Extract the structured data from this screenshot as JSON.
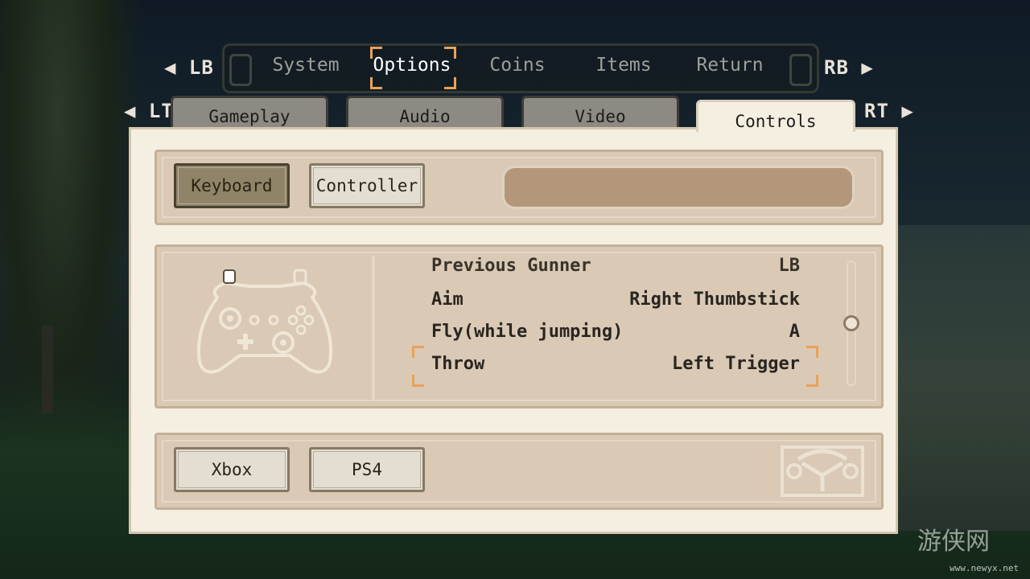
{
  "top_nav": {
    "left_shoulder": "◀ LB",
    "right_shoulder": "RB ▶",
    "items": [
      "System",
      "Options",
      "Coins",
      "Items",
      "Return"
    ],
    "active_index": 1
  },
  "sub_tabs": {
    "left_trigger": "◀ LT",
    "right_trigger": "RT ▶",
    "items": [
      "Gameplay",
      "Audio",
      "Video",
      "Controls"
    ],
    "active_index": 3
  },
  "input_mode": {
    "keyboard": "Keyboard",
    "controller": "Controller",
    "selected": "Keyboard"
  },
  "bindings": [
    {
      "name": "Previous Gunner",
      "key": "LB",
      "partial": true
    },
    {
      "name": "Aim",
      "key": "Right Thumbstick"
    },
    {
      "name": "Fly(while jumping)",
      "key": "A"
    },
    {
      "name": "Throw",
      "key": "Left Trigger",
      "highlighted": true
    }
  ],
  "scroll": {
    "position": 0.5
  },
  "layout_buttons": {
    "xbox": "Xbox",
    "ps4": "PS4"
  },
  "watermark": {
    "text": "游侠网",
    "url": "www.newyx.net"
  },
  "colors": {
    "panel": "#f5efe2",
    "box": "#d9c9b5",
    "accent": "#e8a25a",
    "selected": "#8f8468"
  }
}
